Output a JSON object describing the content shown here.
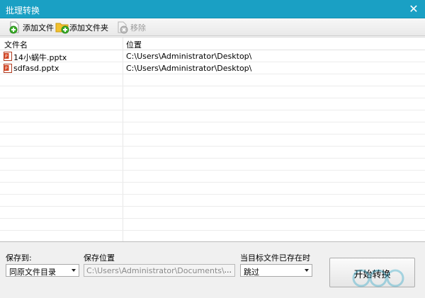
{
  "window": {
    "title": "批理转换",
    "close_glyph": "✕"
  },
  "toolbar": {
    "add_file": {
      "label": "添加文件",
      "icon": "add-file-icon"
    },
    "add_folder": {
      "label": "添加文件夹",
      "icon": "add-folder-icon"
    },
    "remove": {
      "label": "移除",
      "icon": "remove-icon",
      "disabled": true
    }
  },
  "file_list": {
    "columns": [
      "文件名",
      "位置"
    ],
    "rows": [
      {
        "name": "14小蜗牛.pptx",
        "location": "C:\\Users\\Administrator\\Desktop\\"
      },
      {
        "name": "sdfasd.pptx",
        "location": "C:\\Users\\Administrator\\Desktop\\"
      }
    ]
  },
  "bottom": {
    "save_to_label": "保存到:",
    "save_to_value": "同原文件目录",
    "save_location_label": "保存位置",
    "save_location_value": "C:\\Users\\Administrator\\Documents\\",
    "browse_label": "...",
    "conflict_label": "当目标文件已存在时",
    "conflict_value": "跳过",
    "start_label": "开始转换"
  },
  "colors": {
    "titlebar": "#1aa0c4",
    "add_green": "#3dae2b",
    "folder_yellow": "#f2c12e",
    "ppt_red": "#d24726"
  }
}
